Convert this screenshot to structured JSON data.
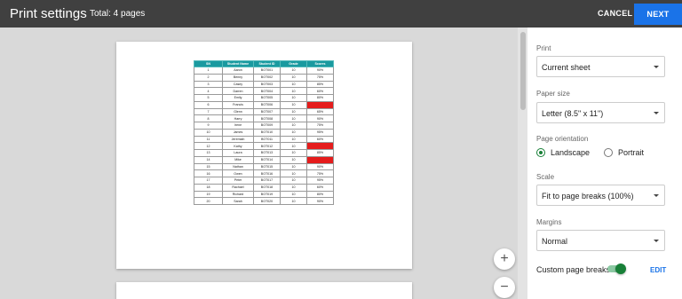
{
  "header": {
    "title": "Print settings",
    "total": "Total: 4 pages",
    "cancel_label": "CANCEL",
    "next_label": "NEXT"
  },
  "sheet": {
    "columns": [
      "SN",
      "Student Name",
      "Student ID",
      "Grade",
      "Scores"
    ],
    "rows": [
      [
        "1",
        "Aaron",
        "BOT001",
        "10",
        "90%"
      ],
      [
        "2",
        "Benny",
        "BOT002",
        "10",
        "75%"
      ],
      [
        "3",
        "Casey",
        "BOT003",
        "10",
        "85%"
      ],
      [
        "4",
        "Darren",
        "BOT004",
        "10",
        "60%"
      ],
      [
        "5",
        "Emily",
        "BOT005",
        "10",
        "80%"
      ],
      [
        "6",
        "Francis",
        "BOT006",
        "10",
        "30%"
      ],
      [
        "7",
        "Glenn",
        "BOT007",
        "10",
        "65%"
      ],
      [
        "8",
        "Harry",
        "BOT008",
        "10",
        "90%"
      ],
      [
        "9",
        "Irene",
        "BOT009",
        "10",
        "75%"
      ],
      [
        "10",
        "James",
        "BOT010",
        "10",
        "95%"
      ],
      [
        "11",
        "Jeremiah",
        "BOT011",
        "10",
        "60%"
      ],
      [
        "12",
        "Kathy",
        "BOT012",
        "10",
        "40%"
      ],
      [
        "13",
        "Laura",
        "BOT013",
        "10",
        "85%"
      ],
      [
        "14",
        "Mike",
        "BOT014",
        "10",
        "35%"
      ],
      [
        "15",
        "Nathan",
        "BOT015",
        "10",
        "90%"
      ],
      [
        "16",
        "Owen",
        "BOT016",
        "10",
        "75%"
      ],
      [
        "17",
        "Peter",
        "BOT017",
        "10",
        "95%"
      ],
      [
        "18",
        "Rachael",
        "BOT018",
        "10",
        "60%"
      ],
      [
        "19",
        "Richard",
        "BOT019",
        "10",
        "80%"
      ],
      [
        "20",
        "Sarah",
        "BOT020",
        "10",
        "90%"
      ]
    ],
    "highlighted_rows": [
      6,
      12,
      14
    ],
    "header_color": "#1a9aa0",
    "highlight_color": "#e51c1c"
  },
  "zoom": {
    "in_icon": "plus-icon",
    "out_icon": "minus-icon",
    "in_symbol": "+",
    "out_symbol": "−"
  },
  "settings": {
    "print_label": "Print",
    "print_value": "Current sheet",
    "paper_label": "Paper size",
    "paper_value": "Letter (8.5\" x 11\")",
    "orientation_label": "Page orientation",
    "orientation_landscape": "Landscape",
    "orientation_portrait": "Portrait",
    "orientation_selected": "Landscape",
    "scale_label": "Scale",
    "scale_value": "Fit to page breaks (100%)",
    "margins_label": "Margins",
    "margins_value": "Normal",
    "custom_breaks_label": "Custom page breaks",
    "custom_breaks_on": true,
    "edit_label": "EDIT"
  },
  "colors": {
    "topbar": "#404040",
    "accent": "#1a73e8",
    "toggle_green": "#188038"
  }
}
